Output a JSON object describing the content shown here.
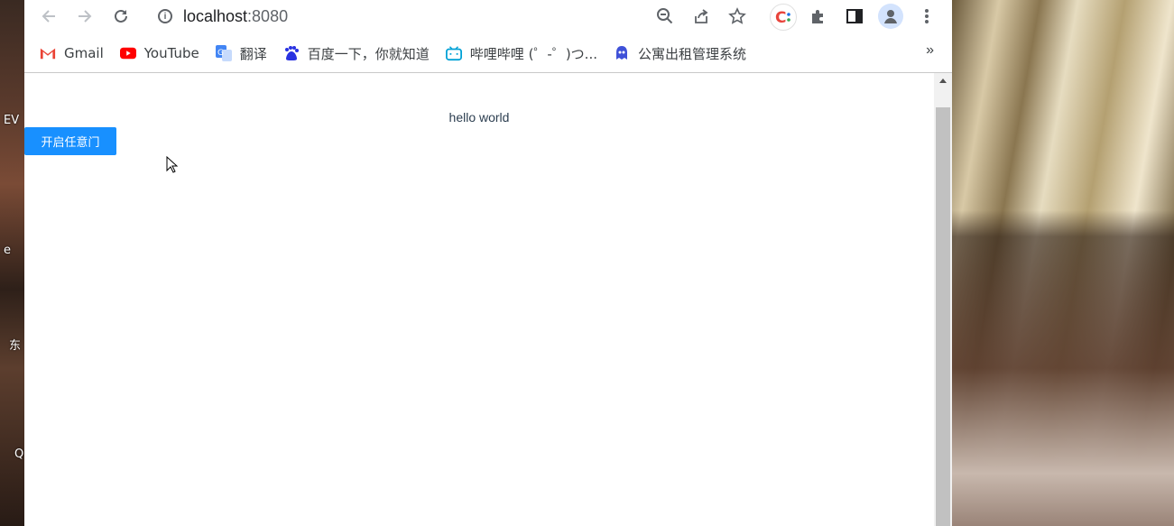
{
  "browser": {
    "url_host": "localhost",
    "url_port": ":8080"
  },
  "bookmarks": [
    {
      "label": "Gmail",
      "icon": "gmail-icon"
    },
    {
      "label": "YouTube",
      "icon": "youtube-icon"
    },
    {
      "label": "翻译",
      "icon": "translate-icon"
    },
    {
      "label": "百度一下，你就知道",
      "icon": "baidu-icon"
    },
    {
      "label": "哔哩哔哩 (゜-゜)つ...",
      "icon": "bilibili-icon"
    },
    {
      "label": "公寓出租管理系统",
      "icon": "app-icon"
    }
  ],
  "bookmarks_more": "»",
  "page": {
    "hello": "hello world",
    "open_button": "开启任意门"
  },
  "desktop": {
    "left_labels": [
      "EV",
      "e",
      "东",
      "Q"
    ]
  },
  "colors": {
    "primary_button": "#1890ff"
  }
}
